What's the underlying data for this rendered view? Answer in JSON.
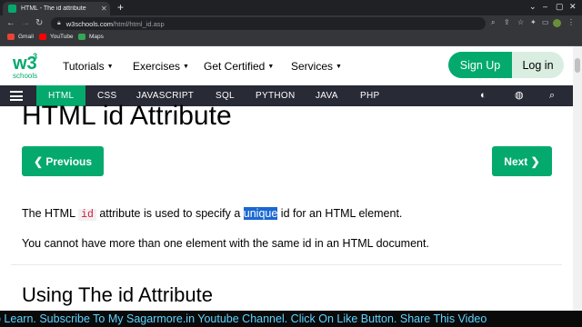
{
  "browser": {
    "tab_title": "HTML - The id attribute",
    "tab_close": "✕",
    "new_tab": "+",
    "url_host": "w3schools.com",
    "url_path": "/html/html_id.asp",
    "bookmarks": [
      {
        "label": "Gmail",
        "color": "#ea4335"
      },
      {
        "label": "YouTube",
        "color": "#ff0000"
      },
      {
        "label": "Maps",
        "color": "#34a853"
      }
    ]
  },
  "site": {
    "logo_text": "w3",
    "logo_sup": "3",
    "logo_sub": "schools",
    "menu": [
      "Tutorials",
      "Exercises",
      "Get Certified",
      "Services"
    ],
    "signup_label": "Sign Up",
    "login_label": "Log in",
    "accent_color": "#04aa6d"
  },
  "langbar": {
    "items": [
      "HTML",
      "CSS",
      "JAVASCRIPT",
      "SQL",
      "PYTHON",
      "JAVA",
      "PHP"
    ],
    "active": "HTML"
  },
  "content": {
    "title": "HTML id Attribute",
    "prev_label": "❮ Previous",
    "next_label": "Next ❯",
    "p1_a": "The HTML ",
    "p1_code": "id",
    "p1_b": " attribute is used to specify a ",
    "p1_selected": "unique",
    "p1_c": " id for an HTML element.",
    "p2": "You cannot have more than one element with the same id in an HTML document.",
    "h2": "Using The id Attribute"
  },
  "overlay": {
    "ticker": "o Learn.   Subscribe To My Sagarmore.in Youtube Channel.   Click On Like Button.   Share This Video"
  }
}
